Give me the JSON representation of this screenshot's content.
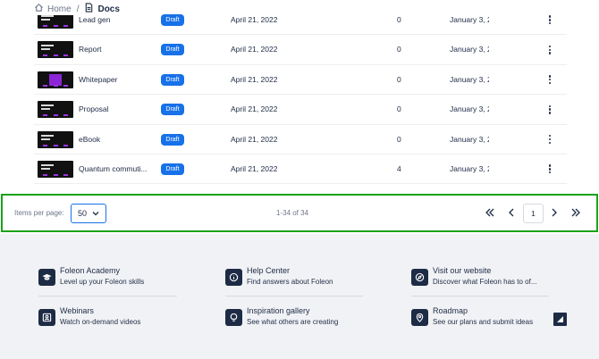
{
  "breadcrumb": {
    "home": "Home",
    "separator": "/",
    "current": "Docs"
  },
  "rows": [
    {
      "name": "Lead gen",
      "status": "Draft",
      "date": "April 21, 2022",
      "count": "0",
      "modified": "January 3, 2",
      "thumb": "dark"
    },
    {
      "name": "Report",
      "status": "Draft",
      "date": "April 21, 2022",
      "count": "0",
      "modified": "January 3, 2",
      "thumb": "dark"
    },
    {
      "name": "Whitepaper",
      "status": "Draft",
      "date": "April 21, 2022",
      "count": "0",
      "modified": "January 3, 2",
      "thumb": "purple"
    },
    {
      "name": "Proposal",
      "status": "Draft",
      "date": "April 21, 2022",
      "count": "0",
      "modified": "January 3, 2",
      "thumb": "dark"
    },
    {
      "name": "eBook",
      "status": "Draft",
      "date": "April 21, 2022",
      "count": "0",
      "modified": "January 3, 2",
      "thumb": "dark"
    },
    {
      "name": "Quantum commuti...",
      "status": "Draft",
      "date": "April 21, 2022",
      "count": "4",
      "modified": "January 3, 2",
      "thumb": "dark"
    }
  ],
  "pagination": {
    "items_per_page_label": "Items per page:",
    "items_per_page": "50",
    "range": "1-34 of 34",
    "page": "1"
  },
  "footer": {
    "items": [
      {
        "title": "Foleon Academy",
        "desc": "Level up your Foleon skills",
        "icon": "graduation-cap-icon"
      },
      {
        "title": "Help Center",
        "desc": "Find answers about Foleon",
        "icon": "info-icon"
      },
      {
        "title": "Visit our website",
        "desc": "Discover what Foleon has to of...",
        "icon": "compass-icon"
      },
      {
        "title": "Webinars",
        "desc": "Watch on-demand videos",
        "icon": "webinar-icon"
      },
      {
        "title": "Inspiration gallery",
        "desc": "See what others are creating",
        "icon": "lightbulb-icon"
      },
      {
        "title": "Roadmap",
        "desc": "See our plans and submit ideas",
        "icon": "map-pin-icon"
      }
    ]
  },
  "colors": {
    "accent": "#1771e8",
    "highlight_border": "#1aa31a",
    "navy": "#1d2b45",
    "thumb_accent": "#8b25d6"
  }
}
